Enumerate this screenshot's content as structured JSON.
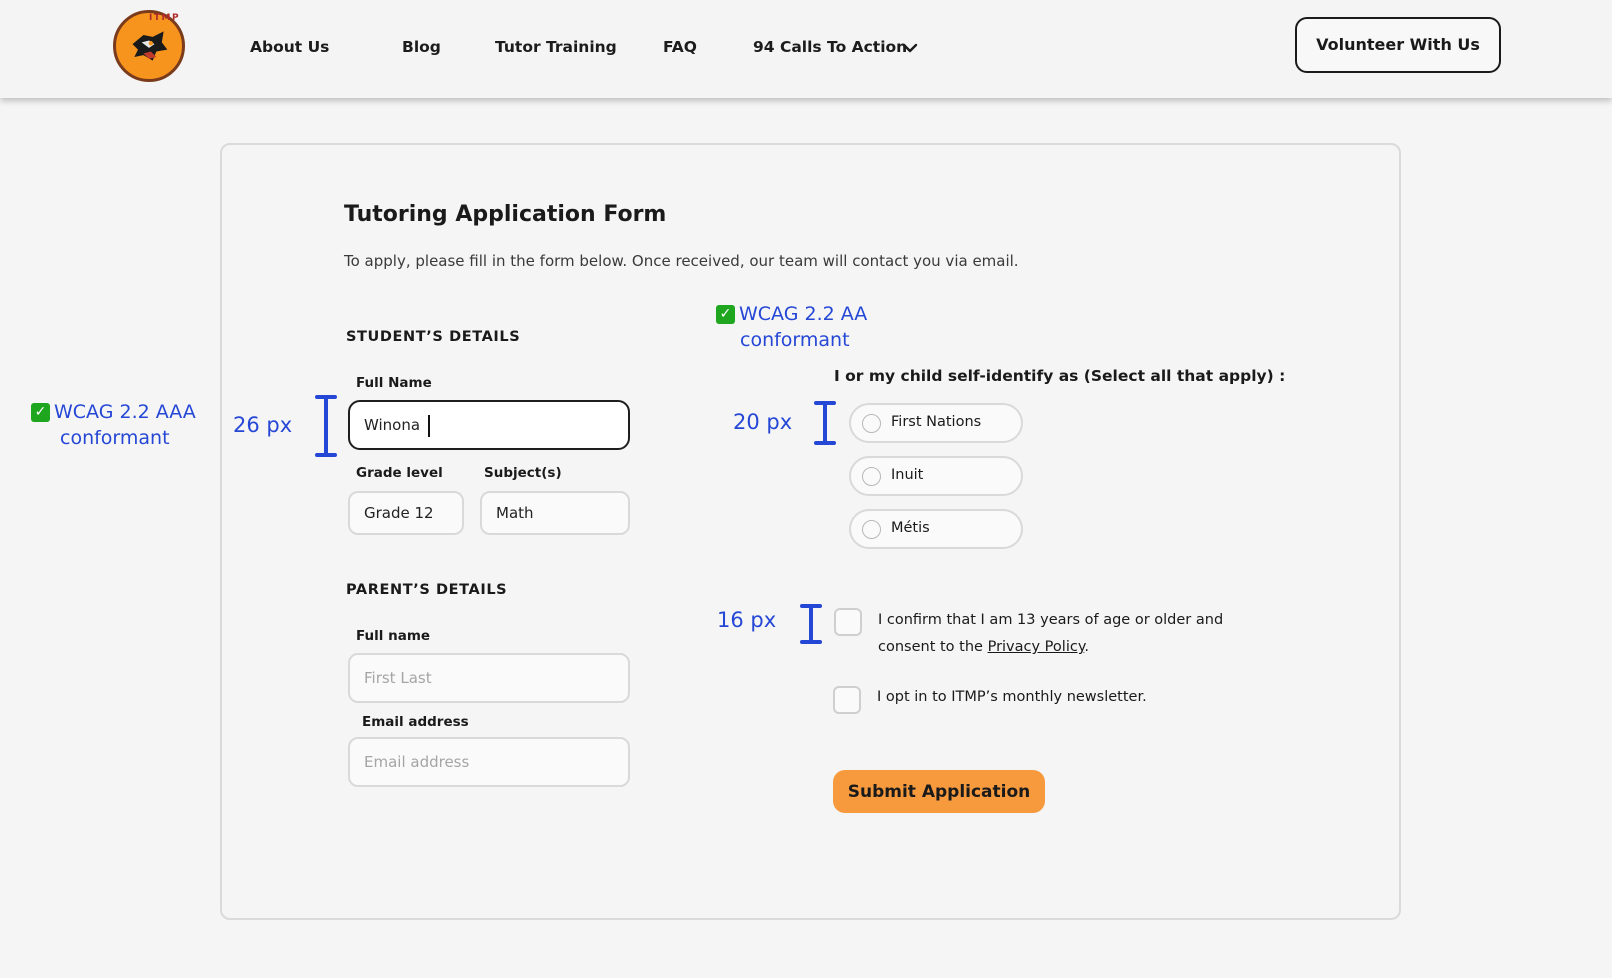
{
  "nav": {
    "logo_text": "ITMP",
    "links": [
      "About Us",
      "Blog",
      "Tutor Training",
      "FAQ",
      "94 Calls To Action"
    ],
    "cta_label": "Volunteer With Us"
  },
  "form": {
    "title": "Tutoring Application Form",
    "description": "To apply, please fill in the form below. Once received, our team will contact you via email.",
    "student": {
      "heading": "STUDENT’S DETAILS",
      "full_name_label": "Full Name",
      "full_name_value": "Winona",
      "grade_label": "Grade level",
      "grade_value": "Grade 12",
      "subject_label": "Subject(s)",
      "subject_value": "Math"
    },
    "parent": {
      "heading": "PARENT’S DETAILS",
      "full_name_label": "Full name",
      "full_name_placeholder": "First Last",
      "email_label": "Email address",
      "email_placeholder": "Email address"
    },
    "identity": {
      "question": "I or my child self-identify as (Select all that apply) :",
      "options": [
        "First Nations",
        "Inuit",
        "Métis"
      ]
    },
    "consent": {
      "line1": "I confirm that I am 13 years of age or older and",
      "line2_prefix": "consent to the ",
      "privacy_link": "Privacy Policy",
      "line2_suffix": "."
    },
    "newsletter": "I opt in to ITMP’s monthly newsletter.",
    "submit_label": "Submit Application"
  },
  "annotations": {
    "aaa_line1": "WCAG 2.2 AAA",
    "aaa_line2": "conformant",
    "aa_line1": "WCAG 2.2 AA",
    "aa_line2": "conformant",
    "size_26": "26 px",
    "size_20": "20 px",
    "size_16": "16 px",
    "check_glyph": "✓"
  },
  "colors": {
    "accent_orange": "#f79a3e",
    "annotation_blue": "#2547d6",
    "check_green": "#1fa61f"
  }
}
